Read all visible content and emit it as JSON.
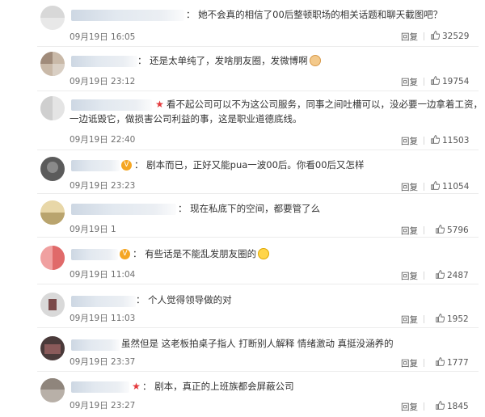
{
  "reply_label": "回复",
  "colors": {
    "vip_badge": "#f5a623",
    "red_star": "#e4393c",
    "like_icon": "#666666"
  },
  "comments": [
    {
      "text_lines": [
        "：  她不会真的相信了00后整顿职场的相关话题和聊天截图吧？"
      ],
      "time": "09月19日 16:05",
      "likes": "32529"
    },
    {
      "text_lines": [
        "：  还是太单纯了，发啥朋友圈，发微博啊"
      ],
      "emoji": "cat-face",
      "time": "09月19日 23:12",
      "likes": "19754"
    },
    {
      "text_lines": [
        "看不起公司可以不为这公司服务，同事之间吐槽可以，没必要一边拿着工资，",
        "一边诋毁它，做损害公司利益的事，这是职业道德底线。"
      ],
      "time": "09月19日 22:40",
      "likes": "11503"
    },
    {
      "text_lines": [
        "：  剧本而已，正好又能pua一波00后。你看00后又怎样"
      ],
      "time": "09月19日 23:23",
      "likes": "11054"
    },
    {
      "text_lines": [
        "：  现在私底下的空间，都要管了么"
      ],
      "time": "09月19日 1",
      "likes": "5796"
    },
    {
      "text_lines": [
        "：  有些话是不能乱发朋友圈的"
      ],
      "emoji": "sweat-smile",
      "time": "09月19日 11:04",
      "likes": "2487"
    },
    {
      "text_lines": [
        "：  个人觉得领导做的对"
      ],
      "time": "09月19日 11:03",
      "likes": "1952"
    },
    {
      "text_lines": [
        "虽然但是 这老板拍桌子指人 打断别人解释 情绪激动 真挺没涵养的"
      ],
      "time": "09月19日 23:37",
      "likes": "1777"
    },
    {
      "text_lines": [
        "：  剧本，真正的上班族都会屏蔽公司"
      ],
      "time": "09月19日 23:27",
      "likes": "1845"
    }
  ]
}
